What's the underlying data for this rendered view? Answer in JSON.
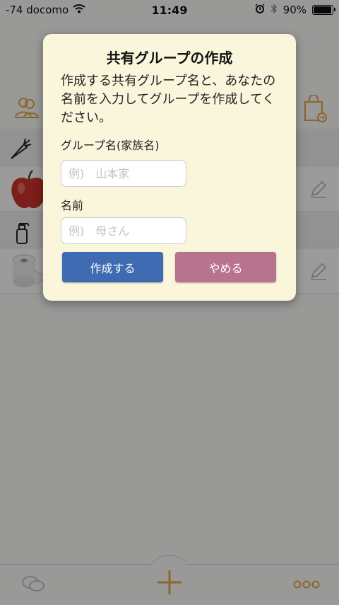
{
  "status_bar": {
    "carrier": "-74 docomo",
    "time": "11:49",
    "battery_percent": "90%",
    "battery_level": 0.9
  },
  "dialog": {
    "title": "共有グループの作成",
    "message": "作成する共有グループ名と、あなたの名前を入力してグループを作成してください。",
    "group_label": "グループ名(家族名)",
    "group_placeholder": "例)　山本家",
    "name_label": "名前",
    "name_placeholder": "例)　母さん",
    "create_label": "作成する",
    "cancel_label": "やめる"
  },
  "colors": {
    "accent_orange": "#e3a34a",
    "create_button": "#3e6bb1",
    "cancel_button": "#b8738f",
    "dialog_bg": "#f9f6dc"
  },
  "icons": [
    "wifi-icon",
    "alarm-icon",
    "bluetooth-icon",
    "battery-icon",
    "group-icon",
    "shopping-bag-icon",
    "carrot-icon",
    "spray-bottle-icon",
    "edit-icon",
    "chat-icon",
    "plus-icon",
    "more-icon"
  ]
}
